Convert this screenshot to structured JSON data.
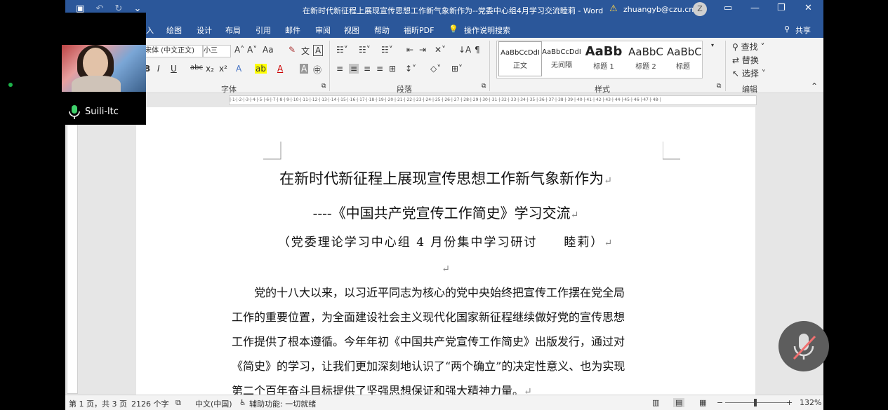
{
  "window": {
    "title": "在新时代新征程上展现宣传思想工作新气象新作为--党委中心组4月学习交流睦莉 - Word",
    "user": "zhuangyb@czu.cn",
    "avatar_letter": "Z"
  },
  "tabs": [
    "入",
    "绘图",
    "设计",
    "布局",
    "引用",
    "邮件",
    "审阅",
    "视图",
    "帮助",
    "福昕PDF",
    "操作说明搜索",
    "共享"
  ],
  "ribbon": {
    "font_name": "宋体 (中文正文)",
    "font_size": "小三",
    "font_group": "字体",
    "paragraph_group": "段落",
    "styles_group": "样式",
    "editing_group": "编辑",
    "styles": [
      {
        "preview": "AaBbCcDdI",
        "name": "正文"
      },
      {
        "preview": "AaBbCcDdI",
        "name": "无间隔"
      },
      {
        "preview": "AaBb",
        "name": "标题 1"
      },
      {
        "preview": "AaBbC",
        "name": "标题 2"
      },
      {
        "preview": "AaBbC",
        "name": "标题"
      }
    ],
    "find": "查找",
    "replace": "替换",
    "select": "选择"
  },
  "document": {
    "title": "在新时代新征程上展现宣传思想工作新气象新作为",
    "subtitle": "----《中国共产党宣传工作简史》学习交流",
    "byline": "（党委理论学习中心组 4 月份集中学习研讨　　睦莉）",
    "paragraph_lines": [
      "党的十八大以来，以习近平同志为核心的党中央始终把宣传工作摆在党全局",
      "工作的重要位置，为全面建设社会主义现代化国家新征程继续做好党的宣传思想",
      "工作提供了根本遵循。今年年初《中国共产党宣传工作简史》出版发行，通过对",
      "《简史》的学习，让我们更加深刻地认识了“两个确立”的决定性意义、也为实现",
      "第二个百年奋斗目标提供了坚强思想保证和强大精神力量。"
    ]
  },
  "status": {
    "page": "第 1 页，共 3 页",
    "words": "2126 个字",
    "lang": "中文(中国)",
    "accessibility": "辅助功能: 一切就绪",
    "zoom": "132%"
  },
  "video": {
    "participant": "Suili-ltc"
  }
}
